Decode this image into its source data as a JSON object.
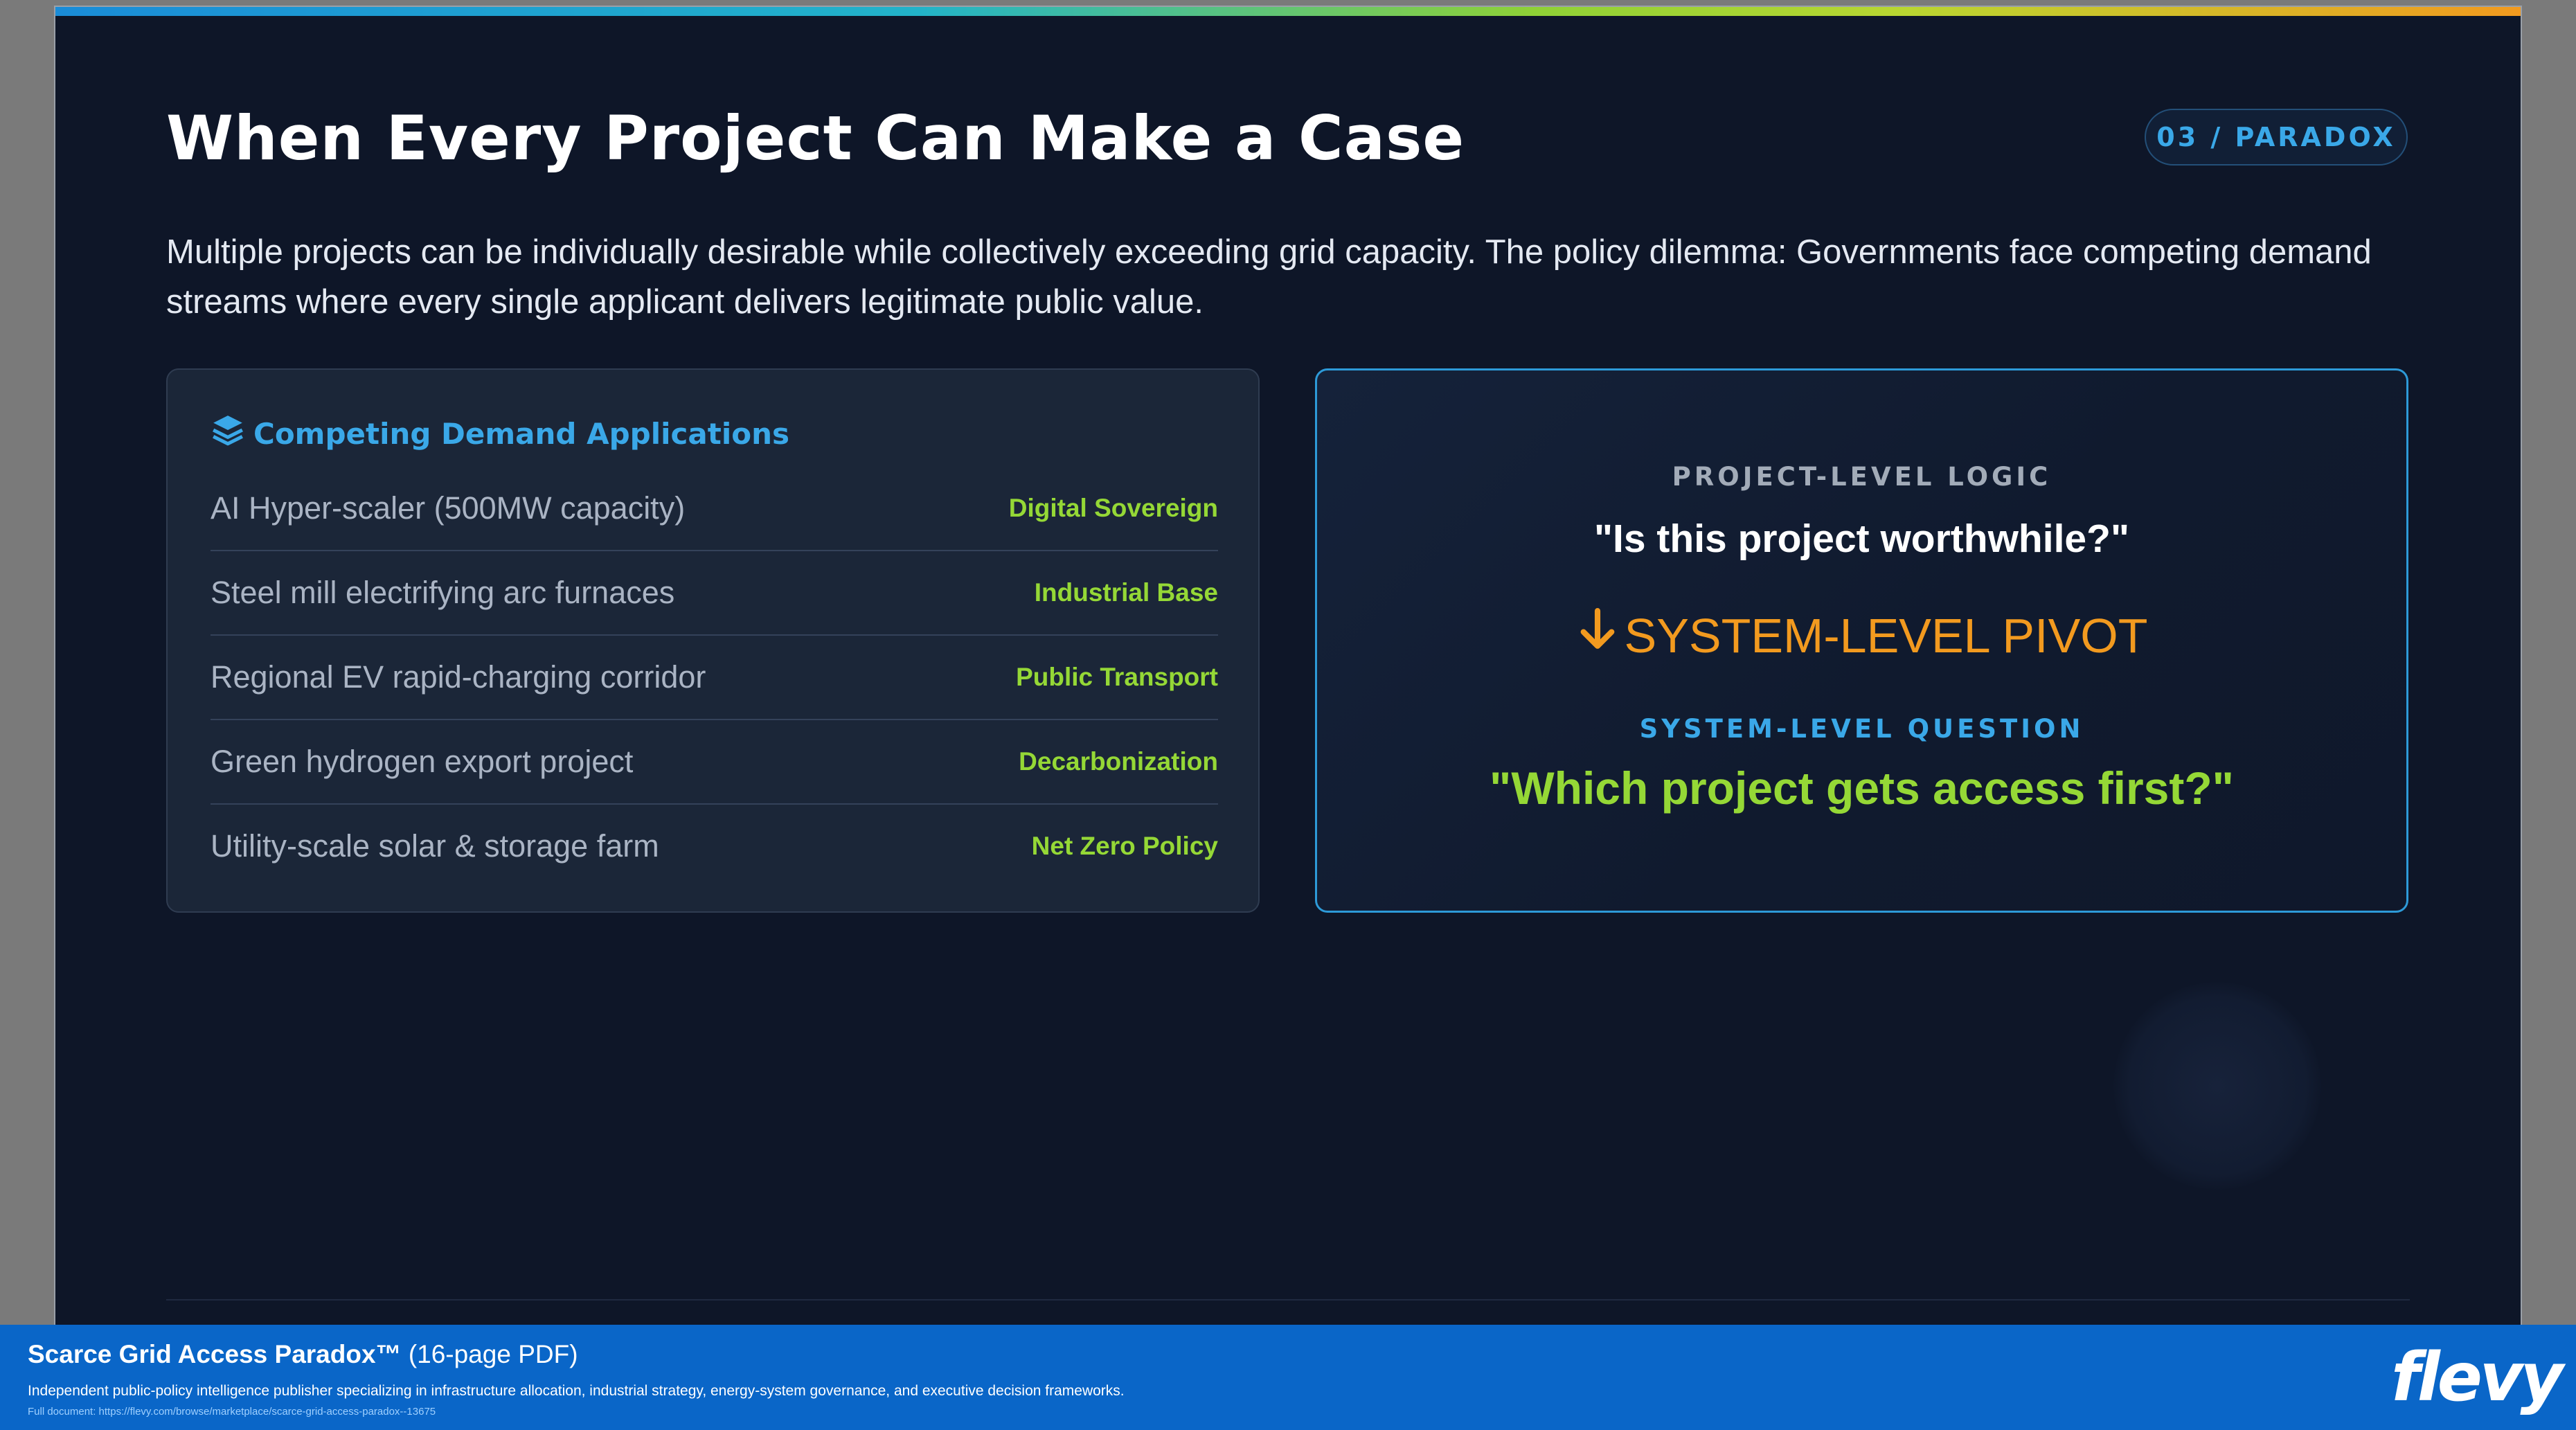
{
  "slide": {
    "title": "When Every Project Can Make a Case",
    "badge": "03 / PARADOX",
    "subtitle": "Multiple projects can be individually desirable while collectively exceeding grid capacity. The policy dilemma: Governments face competing demand streams where every single applicant delivers legitimate public value."
  },
  "left_card": {
    "icon": "layers-icon",
    "heading": "Competing Demand Applications",
    "rows": [
      {
        "name": "AI Hyper-scaler (500MW capacity)",
        "tag": "Digital Sovereign"
      },
      {
        "name": "Steel mill electrifying arc furnaces",
        "tag": "Industrial Base"
      },
      {
        "name": "Regional EV rapid-charging corridor",
        "tag": "Public Transport"
      },
      {
        "name": "Green hydrogen export project",
        "tag": "Decarbonization"
      },
      {
        "name": "Utility-scale solar & storage farm",
        "tag": "Net Zero Policy"
      }
    ]
  },
  "right_card": {
    "kicker1": "PROJECT-LEVEL LOGIC",
    "question1": "\"Is this project worthwhile?\"",
    "pivot_icon": "arrow-down-icon",
    "pivot": "SYSTEM-LEVEL PIVOT",
    "kicker2": "SYSTEM-LEVEL QUESTION",
    "question2": "\"Which project gets access first?\""
  },
  "footer": {
    "title": "Scarce Grid Access Paradox™",
    "title_suffix": " (16-page PDF)",
    "description": "Independent public-policy intelligence publisher specializing in infrastructure allocation, industrial strategy, energy-system governance, and executive decision frameworks.",
    "link": "Full document: https://flevy.com/browse/marketplace/scarce-grid-access-paradox--13675",
    "logo": "flevy"
  },
  "colors": {
    "background": "#0e1628",
    "accent_blue": "#3aa8e8",
    "accent_green": "#95d836",
    "accent_orange": "#f29a1f",
    "footer_blue": "#0a66c8"
  }
}
